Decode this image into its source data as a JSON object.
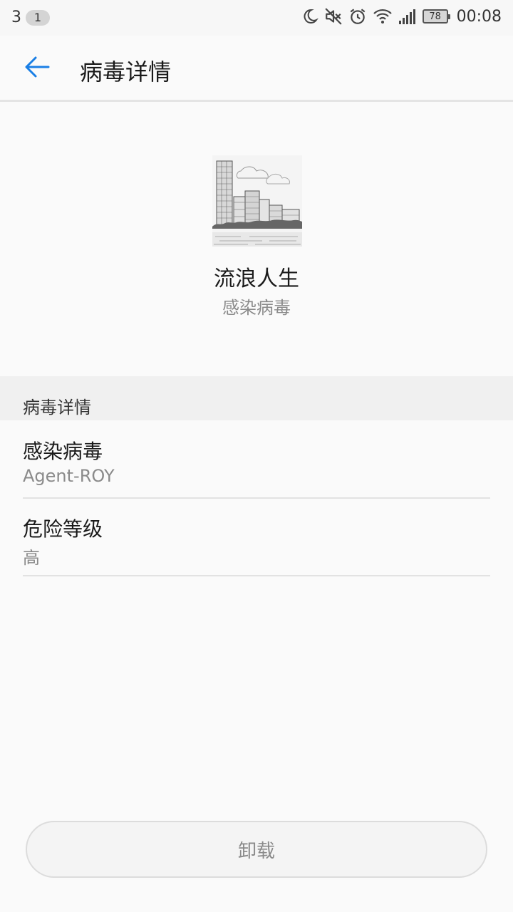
{
  "status_bar": {
    "notification_count": "3",
    "badge": "1",
    "battery": "78",
    "time": "00:08",
    "icons": [
      "moon-icon",
      "mute-icon",
      "alarm-icon",
      "wifi-icon",
      "signal-icon",
      "battery-icon"
    ]
  },
  "app_bar": {
    "title": "病毒详情",
    "back_icon": "arrow-left-icon",
    "accent_color": "#1a7fe5"
  },
  "app_info": {
    "name": "流浪人生",
    "status": "感染病毒",
    "icon": "city-skyline-icon"
  },
  "details": {
    "section_title": "病毒详情",
    "rows": [
      {
        "label": "感染病毒",
        "value": "Agent-ROY"
      },
      {
        "label": "危险等级",
        "value": "高"
      }
    ]
  },
  "actions": {
    "uninstall_label": "卸载"
  }
}
